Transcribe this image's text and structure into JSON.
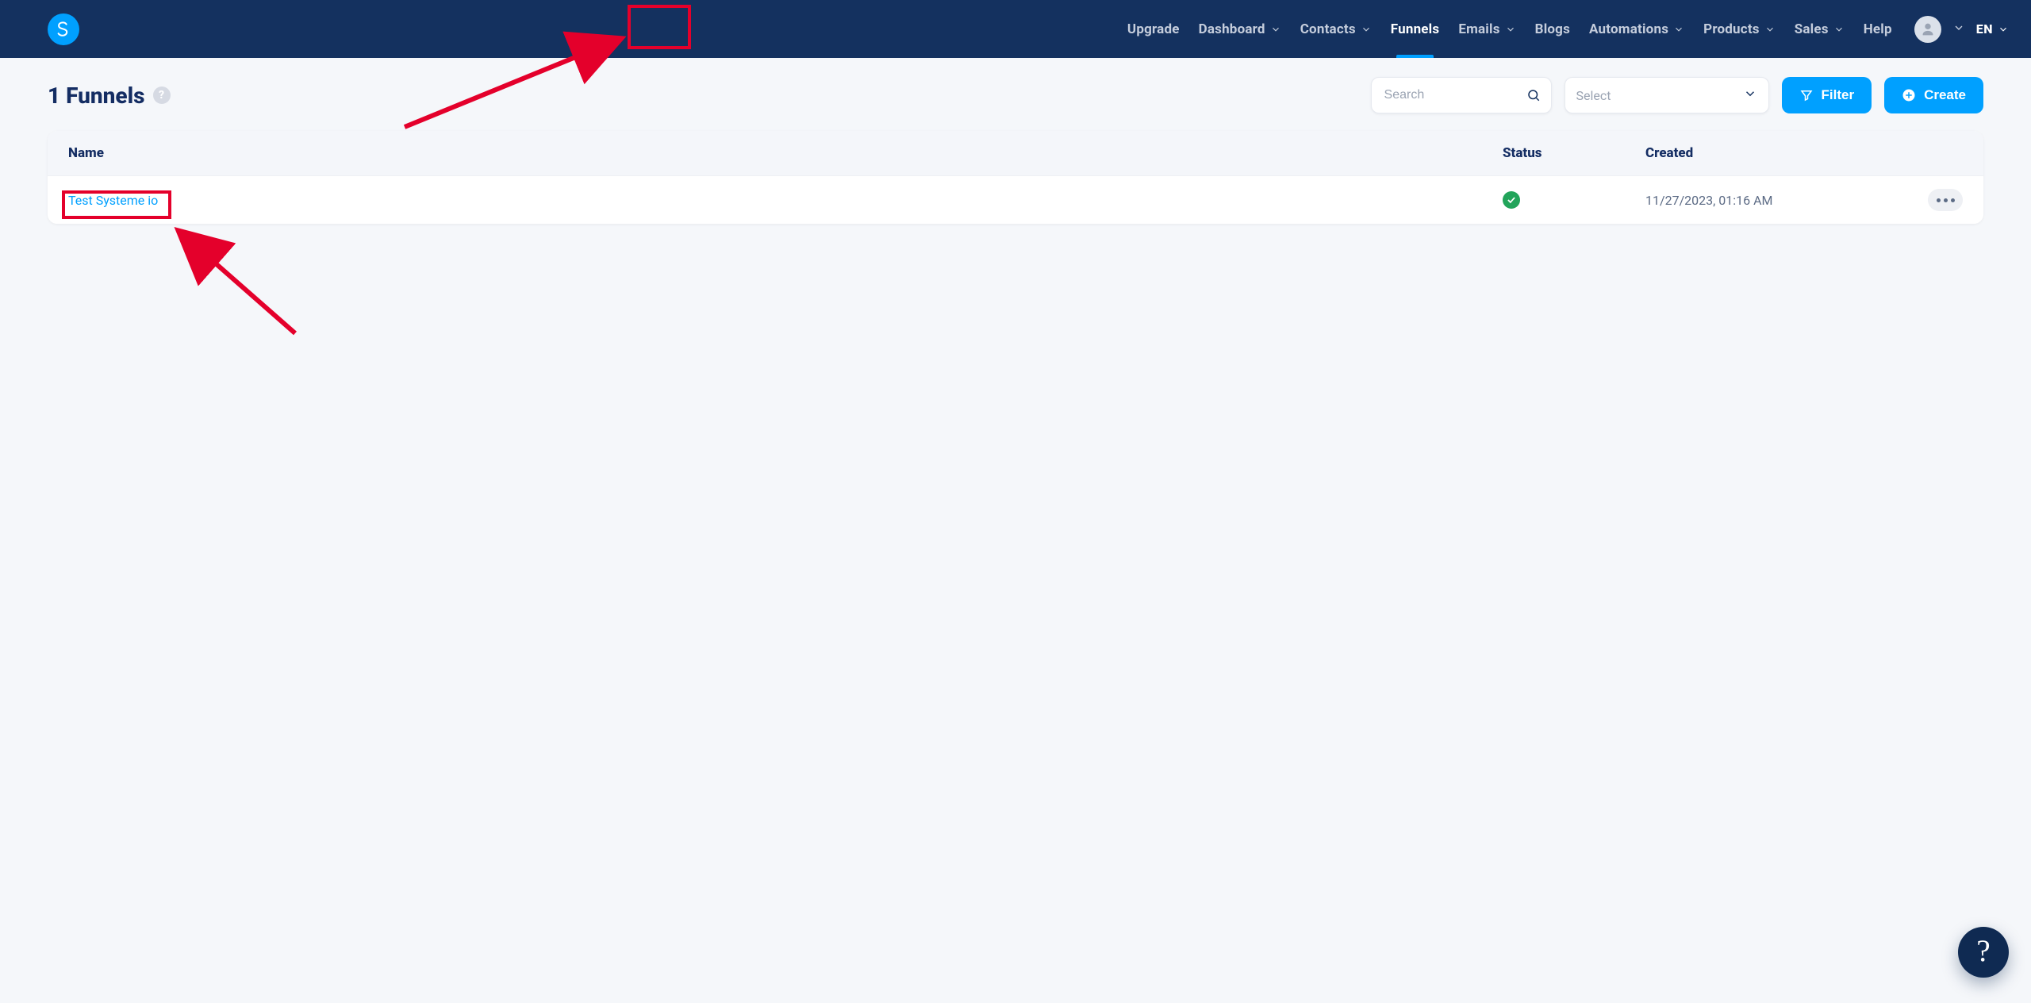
{
  "nav": {
    "upgrade": "Upgrade",
    "dashboard": "Dashboard",
    "contacts": "Contacts",
    "funnels": "Funnels",
    "emails": "Emails",
    "blogs": "Blogs",
    "automations": "Automations",
    "products": "Products",
    "sales": "Sales",
    "help": "Help",
    "language": "EN"
  },
  "page": {
    "title": "1 Funnels",
    "help_tooltip": "?"
  },
  "toolbar": {
    "search_placeholder": "Search",
    "select_placeholder": "Select",
    "filter_label": "Filter",
    "create_label": "Create"
  },
  "table": {
    "headers": {
      "name": "Name",
      "status": "Status",
      "created": "Created"
    },
    "rows": [
      {
        "name": "Test Systeme io",
        "status": "ok",
        "created": "11/27/2023, 01:16 AM"
      }
    ]
  }
}
